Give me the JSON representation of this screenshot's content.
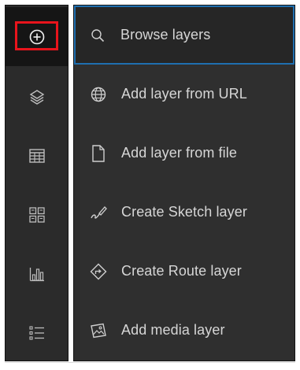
{
  "rail": {
    "items": [
      {
        "icon": "add-circle-icon",
        "active": true
      },
      {
        "icon": "layers-icon"
      },
      {
        "icon": "table-icon"
      },
      {
        "icon": "grid-icon"
      },
      {
        "icon": "bar-chart-icon"
      },
      {
        "icon": "list-icon"
      }
    ]
  },
  "menu": {
    "items": [
      {
        "label": "Browse layers",
        "icon": "search-icon",
        "selected": true
      },
      {
        "label": "Add layer from URL",
        "icon": "globe-icon"
      },
      {
        "label": "Add layer from file",
        "icon": "file-icon"
      },
      {
        "label": "Create Sketch layer",
        "icon": "sketch-icon"
      },
      {
        "label": "Create Route layer",
        "icon": "route-icon"
      },
      {
        "label": "Add media layer",
        "icon": "media-icon"
      }
    ]
  },
  "colors": {
    "rail_bg": "#2b2b2b",
    "menu_bg": "#2f2f2f",
    "text": "#d6d6d6",
    "selection_border": "#1f6fb0",
    "highlight_outline": "#e8141c"
  }
}
